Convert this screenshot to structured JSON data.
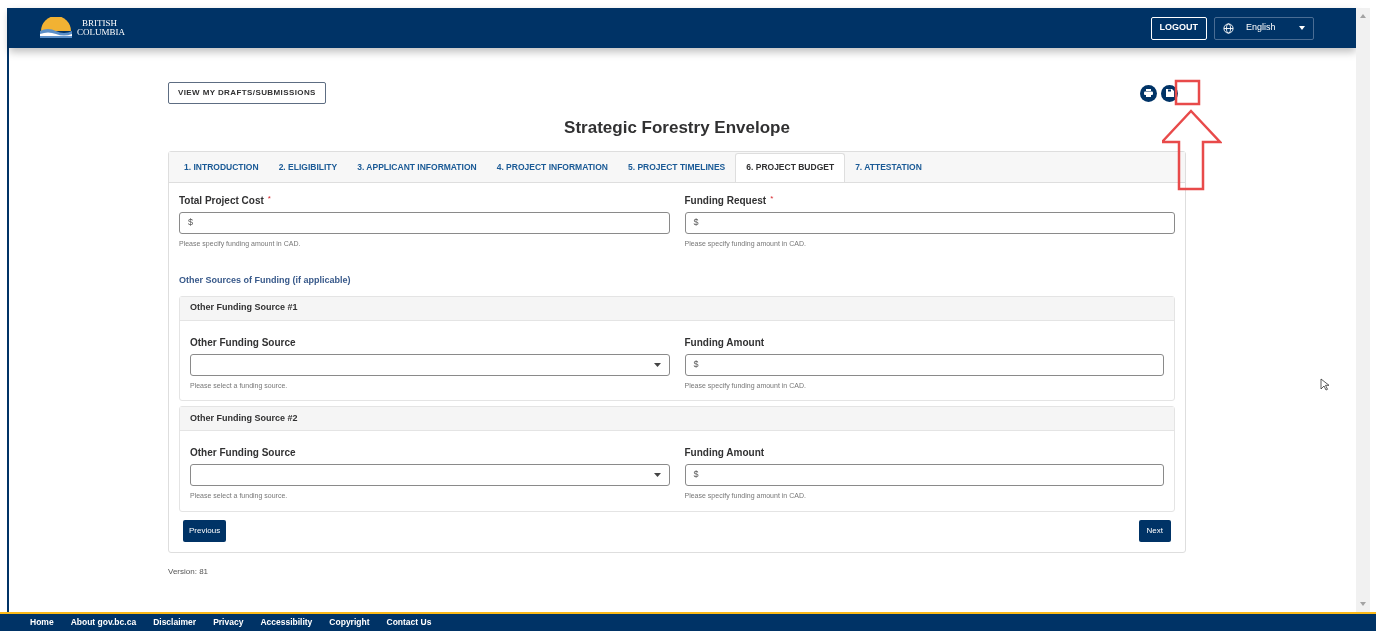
{
  "header": {
    "logo_lines": [
      "BRITISH",
      "COLUMBIA"
    ],
    "logout": "LOGOUT",
    "language": "English"
  },
  "drafts_button": "VIEW MY DRAFTS/SUBMISSIONS",
  "title": "Strategic Forestry Envelope",
  "tabs": [
    {
      "label": "1. INTRODUCTION",
      "selected": false
    },
    {
      "label": "2. ELIGIBILITY",
      "selected": false
    },
    {
      "label": "3. APPLICANT INFORMATION",
      "selected": false
    },
    {
      "label": "4. PROJECT INFORMATION",
      "selected": false
    },
    {
      "label": "5. PROJECT TIMELINES",
      "selected": false
    },
    {
      "label": "6. PROJECT BUDGET",
      "selected": true
    },
    {
      "label": "7. ATTESTATION",
      "selected": false
    }
  ],
  "top_fields": [
    {
      "label": "Total Project Cost",
      "required_mark": "*",
      "prefix": "$",
      "help": "Please specify funding amount in CAD."
    },
    {
      "label": "Funding Request",
      "required_mark": "*",
      "prefix": "$",
      "help": "Please specify funding amount in CAD."
    }
  ],
  "other_sources_heading": "Other Sources of Funding (if applicable)",
  "panels": [
    {
      "title": "Other Funding Source #1",
      "select_label": "Other Funding Source",
      "select_help": "Please select a funding source.",
      "amount_label": "Funding Amount",
      "amount_prefix": "$",
      "amount_help": "Please specify funding amount in CAD."
    },
    {
      "title": "Other Funding Source #2",
      "select_label": "Other Funding Source",
      "select_help": "Please select a funding source.",
      "amount_label": "Funding Amount",
      "amount_prefix": "$",
      "amount_help": "Please specify funding amount in CAD."
    }
  ],
  "previous": "Previous",
  "next": "Next",
  "version": "Version: 81",
  "footer_links": [
    "Home",
    "About gov.bc.ca",
    "Disclaimer",
    "Privacy",
    "Accessibility",
    "Copyright",
    "Contact Us"
  ]
}
